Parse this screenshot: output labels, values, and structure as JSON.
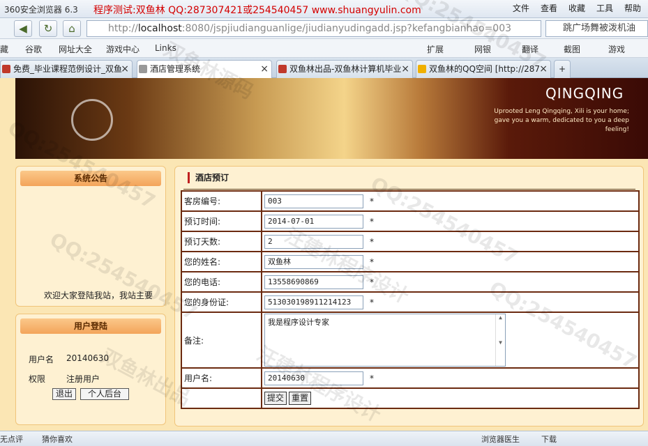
{
  "browser": {
    "app_title": "360安全浏览器 6.3",
    "promo_text": "程序测试:双鱼林 QQ:287307421或254540457 www.shuangyulin.com",
    "menus": [
      "文件",
      "查看",
      "收藏",
      "工具",
      "帮助"
    ],
    "url_prefix": "http://",
    "url_host": "localhost",
    "url_rest": ":8080/jspjiudianguanlige/jiudianyudingadd.jsp?kefangbianhao=003",
    "search_text": "跳广场舞被泼机油",
    "bookmarks": [
      "藏",
      "谷歌",
      "网址大全",
      "游戏中心",
      "Links"
    ],
    "toolbar_right": [
      "扩展",
      "网银",
      "翻译",
      "截图",
      "游戏"
    ],
    "tabs": [
      {
        "label": "免费_毕业课程范例设计_双鱼"
      },
      {
        "label": "酒店管理系统"
      },
      {
        "label": "双鱼林出品-双鱼林计算机毕业"
      },
      {
        "label": "双鱼林的QQ空间 [http://287"
      }
    ],
    "status_left": [
      "无点评",
      "猜你喜欢"
    ],
    "status_right": [
      "浏览器医生",
      "下载"
    ]
  },
  "banner": {
    "title": "QINGQING",
    "tagline": "Uprooted Leng Qingqing, Xili is your home; gave you a warm, dedicated to you a deep feeling!"
  },
  "sidebar": {
    "notice_title": "系统公告",
    "notice_text": "欢迎大家登陆我站，我站主要",
    "login_title": "用户登陆",
    "username_label": "用户名",
    "username_value": "20140630",
    "role_label": "权限",
    "role_value": "注册用户",
    "logout_label": "退出",
    "profile_label": "个人后台"
  },
  "form": {
    "title": "酒店预订",
    "room_label": "客房编号:",
    "room_value": "003",
    "date_label": "预订时间:",
    "date_value": "2014-07-01",
    "days_label": "预订天数:",
    "days_value": "2",
    "name_label": "您的姓名:",
    "name_value": "双鱼林",
    "phone_label": "您的电话:",
    "phone_value": "13558690869",
    "id_label": "您的身份证:",
    "id_value": "513030198911214123",
    "note_label": "备注:",
    "note_value": "我是程序设计专家",
    "user_label": "用户名:",
    "user_value": "20140630",
    "required_mark": "*",
    "submit_label": "提交",
    "reset_label": "重置"
  },
  "watermarks": [
    "QQ:254540457",
    "双鱼林源码",
    "汪建林程序设计",
    "双鱼林出品"
  ],
  "colors": {
    "page_bg": "#fbe6b4",
    "border": "#6b2a10",
    "panel_header": "#f3a45a",
    "title_accent": "#c02020"
  }
}
